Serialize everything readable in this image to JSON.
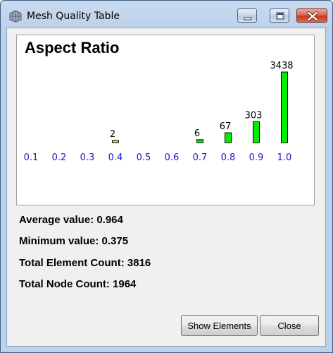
{
  "window": {
    "title": "Mesh Quality Table"
  },
  "chart_data": {
    "type": "bar",
    "title": "Aspect Ratio",
    "categories": [
      "0.1",
      "0.2",
      "0.3",
      "0.4",
      "0.5",
      "0.6",
      "0.7",
      "0.8",
      "0.9",
      "1.0"
    ],
    "values": [
      0,
      0,
      0,
      2,
      0,
      0,
      6,
      67,
      303,
      3438
    ],
    "value_labels": [
      "",
      "",
      "",
      "2",
      "",
      "",
      "6",
      "67",
      "303",
      "3438"
    ],
    "bar_colors": [
      "#00ee00",
      "#00ee00",
      "#00ee00",
      "#f0d040",
      "#00ee00",
      "#00ee00",
      "#00ee00",
      "#00ee00",
      "#00ee00",
      "#00ee00"
    ],
    "tick_color": "#1515d6",
    "xlabel": "",
    "ylabel": "",
    "grid": false,
    "legend": "none"
  },
  "stats": {
    "average": "Average value: 0.964",
    "minimum": "Minimum value: 0.375",
    "element_count": "Total Element Count: 3816",
    "node_count": "Total Node Count: 1964"
  },
  "buttons": {
    "show_elements": "Show Elements",
    "close": "Close"
  },
  "icons": {
    "app": "mesh-icon",
    "minimize": "minimize-icon",
    "maximize": "maximize-icon",
    "close": "close-icon"
  }
}
